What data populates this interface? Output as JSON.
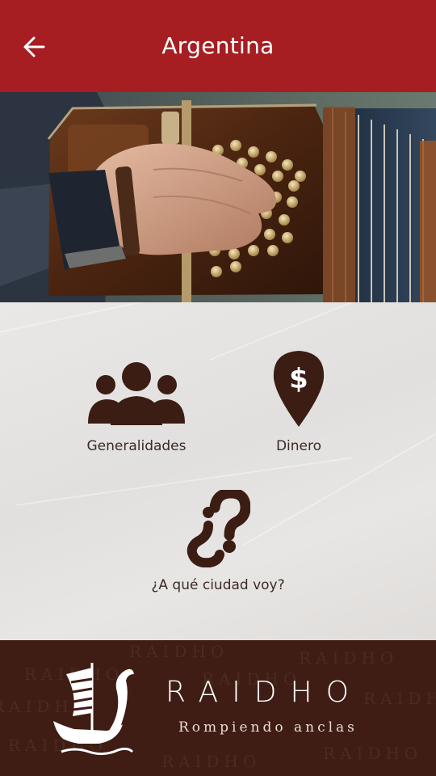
{
  "header": {
    "title": "Argentina",
    "back_icon": "arrow-left-icon",
    "background_color": "#a61e22"
  },
  "hero": {
    "description_icon": "bandoneon-photo"
  },
  "menu": [
    {
      "label": "Generalidades",
      "icon": "people-group-icon"
    },
    {
      "label": "Dinero",
      "icon": "map-pin-dollar-icon"
    },
    {
      "label": "¿A qué ciudad voy?",
      "icon": "question-marks-icon"
    }
  ],
  "footer": {
    "brand": "RAIDHO",
    "tagline": "Rompiendo anclas",
    "watermark_text": "RAIDHO",
    "logo_icon": "ship-logo-icon",
    "background_color": "#3f1d14"
  },
  "colors": {
    "icon_brown": "#3b1d14",
    "content_bg": "#e6e4e2"
  }
}
